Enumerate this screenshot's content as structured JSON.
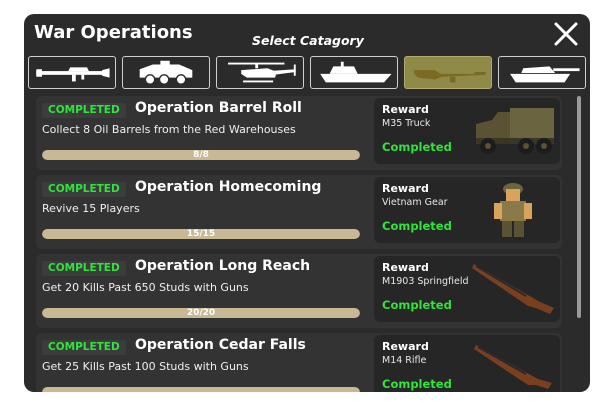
{
  "window": {
    "title": "War Operations",
    "subtitle": "Select Catagory"
  },
  "categories": [
    {
      "name": "launcher",
      "selected": false
    },
    {
      "name": "armored-car",
      "selected": false
    },
    {
      "name": "helicopter",
      "selected": false
    },
    {
      "name": "boat",
      "selected": false
    },
    {
      "name": "rifle",
      "selected": true
    },
    {
      "name": "tank",
      "selected": false
    }
  ],
  "operations": [
    {
      "badge": "COMPLETED",
      "title": "Operation Barrel Roll",
      "desc": "Collect 8 Oil Barrels from the Red Warehouses",
      "progress_text": "8/8",
      "progress": 1.0,
      "reward": {
        "label": "Reward",
        "item": "M35 Truck",
        "status": "Completed",
        "icon": "truck"
      }
    },
    {
      "badge": "COMPLETED",
      "title": "Operation Homecoming",
      "desc": "Revive 15 Players",
      "progress_text": "15/15",
      "progress": 1.0,
      "reward": {
        "label": "Reward",
        "item": "Vietnam Gear",
        "status": "Completed",
        "icon": "soldier"
      }
    },
    {
      "badge": "COMPLETED",
      "title": "Operation Long Reach",
      "desc": "Get 20 Kills Past 650 Studs with Guns",
      "progress_text": "20/20",
      "progress": 1.0,
      "reward": {
        "label": "Reward",
        "item": "M1903 Springfield",
        "status": "Completed",
        "icon": "rifle"
      }
    },
    {
      "badge": "COMPLETED",
      "title": "Operation Cedar Falls",
      "desc": "Get 25 Kills Past 100 Studs with Guns",
      "progress_text": "",
      "progress": 1.0,
      "reward": {
        "label": "Reward",
        "item": "M14 Rifle",
        "status": "Completed",
        "icon": "rifle"
      }
    }
  ],
  "colors": {
    "panel": "#2b2b2b",
    "card": "#333333",
    "accent_green": "#2ee53a",
    "selected_category": "#8f8a48",
    "bar_fill": "#c8b894"
  }
}
